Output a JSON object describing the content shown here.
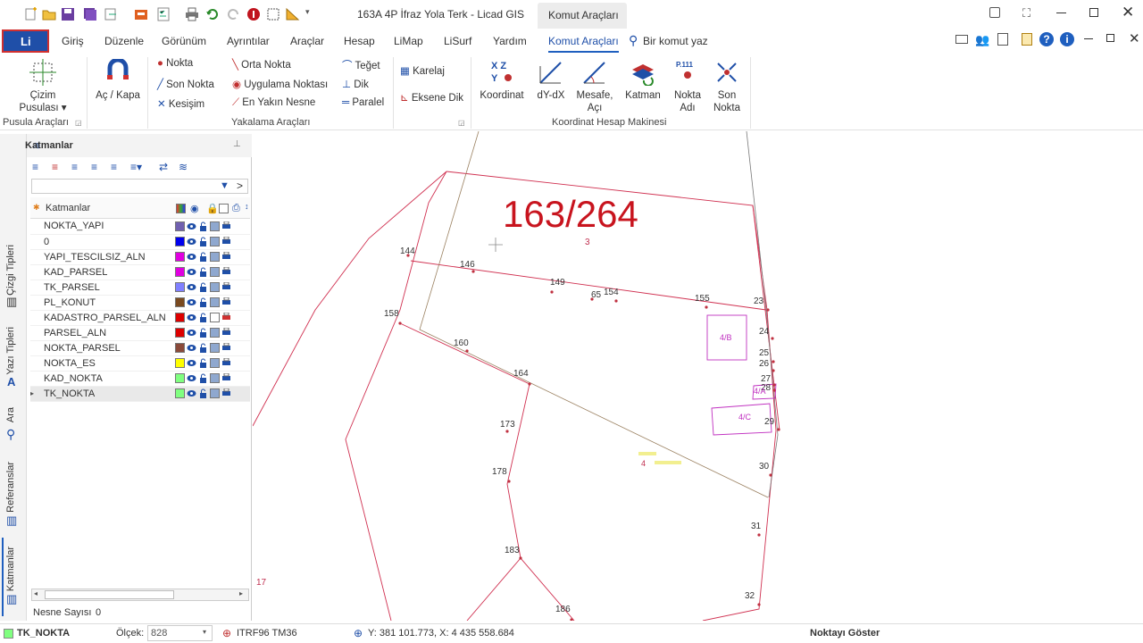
{
  "window": {
    "title": "163A 4P İfraz Yola Terk  -  Licad GIS",
    "context_tab": "Komut Araçları"
  },
  "app_button": "Li",
  "menu": {
    "items": [
      "Giriş",
      "Düzenle",
      "Görünüm",
      "Ayrıntılar",
      "Araçlar",
      "Hesap",
      "LiMap",
      "LiSurf",
      "Yardım",
      "Komut Araçları"
    ],
    "search_label": "Bir komut yaz"
  },
  "ribbon": {
    "pusula": {
      "cizim": "Çizim",
      "pusulasi": "Pusulası",
      "ac_kapa": "Aç / Kapa",
      "group": "Pusula Araçları"
    },
    "yakalama": {
      "col1": [
        "Nokta",
        "Son Nokta",
        "Kesişim"
      ],
      "col2": [
        "Orta Nokta",
        "Uygulama Noktası",
        "En Yakın Nesne"
      ],
      "col3": [
        "Teğet",
        "Dik",
        "Paralel"
      ],
      "col4": [
        "Karelaj",
        "Eksene Dik"
      ],
      "group": "Yakalama Araçları"
    },
    "koordinat": {
      "buttons": [
        {
          "l1": "Koordinat",
          "l2": ""
        },
        {
          "l1": "dY-dX",
          "l2": ""
        },
        {
          "l1": "Mesafe,",
          "l2": "Açı"
        },
        {
          "l1": "Katman",
          "l2": ""
        },
        {
          "l1": "Nokta",
          "l2": "Adı"
        },
        {
          "l1": "Son",
          "l2": "Nokta"
        }
      ],
      "group": "Koordinat Hesap Makinesi"
    }
  },
  "side_tabs": [
    "Çizgi Tipleri",
    "Yazı Tipleri",
    "Ara",
    "Referanslar",
    "Katmanlar"
  ],
  "layers_panel": {
    "title": "Katmanlar",
    "column_header": "Katmanlar",
    "rows": [
      {
        "name": "NOKTA_YAPI",
        "color": "#7060b0"
      },
      {
        "name": "0",
        "color": "#0000ee"
      },
      {
        "name": "YAPI_TESCILSIZ_ALN",
        "color": "#e000e0"
      },
      {
        "name": "KAD_PARSEL",
        "color": "#e000e0"
      },
      {
        "name": "TK_PARSEL",
        "color": "#8080ff"
      },
      {
        "name": "PL_KONUT",
        "color": "#7a4a20"
      },
      {
        "name": "KADASTRO_PARSEL_ALN",
        "color": "#dd0000"
      },
      {
        "name": "PARSEL_ALN",
        "color": "#dd0000"
      },
      {
        "name": "NOKTA_PARSEL",
        "color": "#8a4a3a"
      },
      {
        "name": "NOKTA_ES",
        "color": "#ffff00"
      },
      {
        "name": "KAD_NOKTA",
        "color": "#80ff80"
      },
      {
        "name": "TK_NOKTA",
        "color": "#80ff80"
      }
    ],
    "object_count_label": "Nesne Sayısı",
    "object_count": "0"
  },
  "drawing": {
    "parcel_title": "163/264",
    "parcel_sub": "3",
    "points": [
      "144",
      "146",
      "149",
      "65",
      "154",
      "155",
      "23",
      "158",
      "160",
      "164",
      "173",
      "178",
      "183",
      "186",
      "24",
      "25",
      "26",
      "27",
      "28",
      "29",
      "30",
      "31",
      "32",
      "17"
    ],
    "buildings": [
      "4/B",
      "4/A",
      "4/C"
    ],
    "small_label": "4"
  },
  "status": {
    "layer": "TK_NOKTA",
    "scale_label": "Ölçek:",
    "scale_value": "828",
    "crs": "ITRF96 TM36",
    "coords": "Y: 381 101.773, X: 4 435 558.684",
    "hint": "Noktayı Göster"
  },
  "colors": {
    "accent": "#1f5fbf",
    "parcel_line": "#d03050",
    "building": "#c030c0"
  }
}
